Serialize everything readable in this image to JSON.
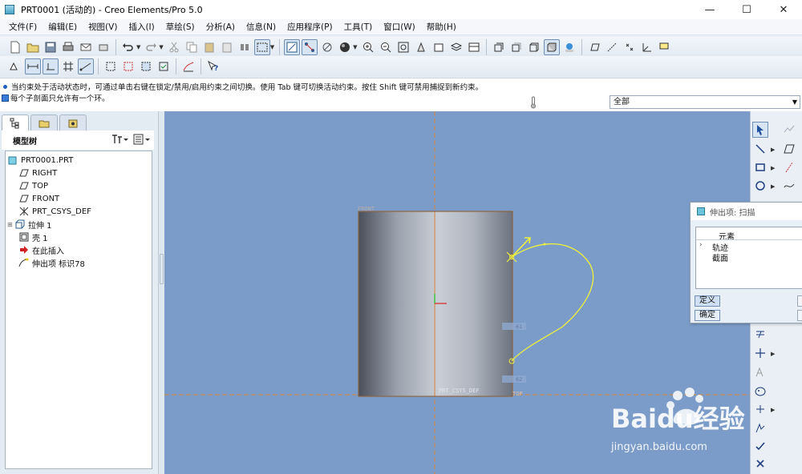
{
  "window": {
    "title": "PRT0001 (活动的) - Creo Elements/Pro 5.0",
    "controls": [
      "minimize",
      "maximize",
      "close"
    ]
  },
  "menubar": {
    "items": [
      "文件(F)",
      "编辑(E)",
      "视图(V)",
      "插入(I)",
      "草绘(S)",
      "分析(A)",
      "信息(N)",
      "应用程序(P)",
      "工具(T)",
      "窗口(W)",
      "帮助(H)"
    ]
  },
  "messages": {
    "line1": "当约束处于活动状态时，可通过单击右键在锁定/禁用/启用约束之间切换。使用 Tab 键可切换活动约束。按住 Shift 键可禁用捕捉到新约束。",
    "line2": "每个子剖面只允许有一个环。"
  },
  "filter": {
    "selected": "全部"
  },
  "model_tree": {
    "header": "模型树",
    "items": [
      {
        "label": "PRT0001.PRT",
        "icon": "part-icon"
      },
      {
        "label": "RIGHT",
        "icon": "datum-plane-icon"
      },
      {
        "label": "TOP",
        "icon": "datum-plane-icon"
      },
      {
        "label": "FRONT",
        "icon": "datum-plane-icon"
      },
      {
        "label": "PRT_CSYS_DEF",
        "icon": "csys-icon"
      },
      {
        "label": "拉伸 1",
        "icon": "extrude-icon"
      },
      {
        "label": "壳 1",
        "icon": "shell-icon"
      },
      {
        "label": "在此插入",
        "icon": "insert-arrow-icon"
      },
      {
        "label": "伸出项 标识78",
        "icon": "sweep-icon"
      }
    ]
  },
  "viewport": {
    "labels": {
      "front": "FRONT",
      "csys": "PRT_CSYS_DEF",
      "top": "TOP",
      "dim1": "61",
      "dim2": "62"
    },
    "colors": {
      "background": "#7b9cc8",
      "sketch": "#f0f23a",
      "datum": "#d8833a"
    }
  },
  "dialog": {
    "title": "伸出项: 扫描",
    "column": "元素",
    "rows": [
      "轨迹",
      "截面"
    ],
    "define_button": "定义",
    "ok_button": "确定"
  },
  "watermark": {
    "brand": "Baidu经验",
    "url": "jingyan.baidu.com"
  }
}
